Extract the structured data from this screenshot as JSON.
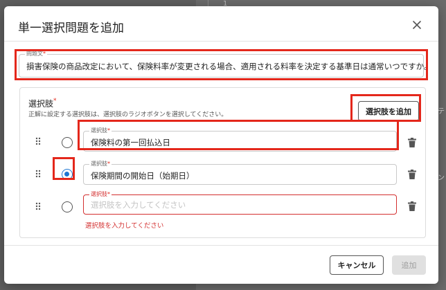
{
  "background": {
    "line_number": "1"
  },
  "dialog": {
    "title": "単一選択問題を追加",
    "question": {
      "label": "問題文",
      "required_mark": "*",
      "value": "損害保険の商品改定において、保険料率が変更される場合、適用される料率を決定する基準日は通常いつですか。"
    },
    "choices_section": {
      "title": "選択肢",
      "required_mark": "*",
      "help": "正解に設定する選択肢は、選択肢のラジオボタンを選択してください。",
      "add_button": "選択肢を追加",
      "choices": [
        {
          "label": "選択肢",
          "required_mark": "*",
          "value": "保険料の第一回払込日",
          "selected": false
        },
        {
          "label": "選択肢",
          "required_mark": "*",
          "value": "保険期間の開始日（始期日）",
          "selected": true
        },
        {
          "label": "選択肢",
          "required_mark": "*",
          "value": "",
          "placeholder": "選択肢を入力してください",
          "selected": false,
          "error": "選択肢を入力してください"
        }
      ]
    },
    "footer": {
      "cancel": "キャンセル",
      "submit": "追加"
    }
  },
  "icons": {
    "close": "close-icon",
    "drag": "drag-handle-icon",
    "delete": "trash-icon"
  },
  "colors": {
    "highlight": "#e4271b",
    "radio_selected": "#1e76d2",
    "error": "#d32f2f",
    "disabled_button": "#e0e0e0"
  }
}
